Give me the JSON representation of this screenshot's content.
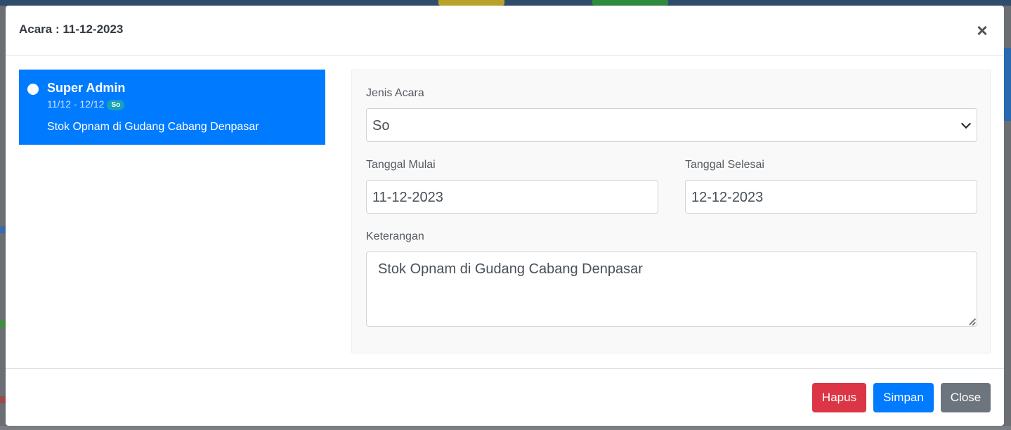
{
  "modal": {
    "title": "Acara : 11-12-2023"
  },
  "event": {
    "user": "Super Admin",
    "dates": "11/12 - 12/12",
    "badge": "So",
    "description": "Stok Opnam di Gudang Cabang Denpasar"
  },
  "form": {
    "jenis_label": "Jenis Acara",
    "jenis_value": "So",
    "mulai_label": "Tanggal Mulai",
    "mulai_value": "11-12-2023",
    "selesai_label": "Tanggal Selesai",
    "selesai_value": "12-12-2023",
    "keterangan_label": "Keterangan",
    "keterangan_value": "Stok Opnam di Gudang Cabang Denpasar"
  },
  "footer": {
    "delete_label": "Hapus",
    "save_label": "Simpan",
    "close_label": "Close"
  },
  "colors": {
    "primary": "#007bff",
    "danger": "#dc3545",
    "secondary": "#6c757d",
    "info": "#17a2b8"
  }
}
